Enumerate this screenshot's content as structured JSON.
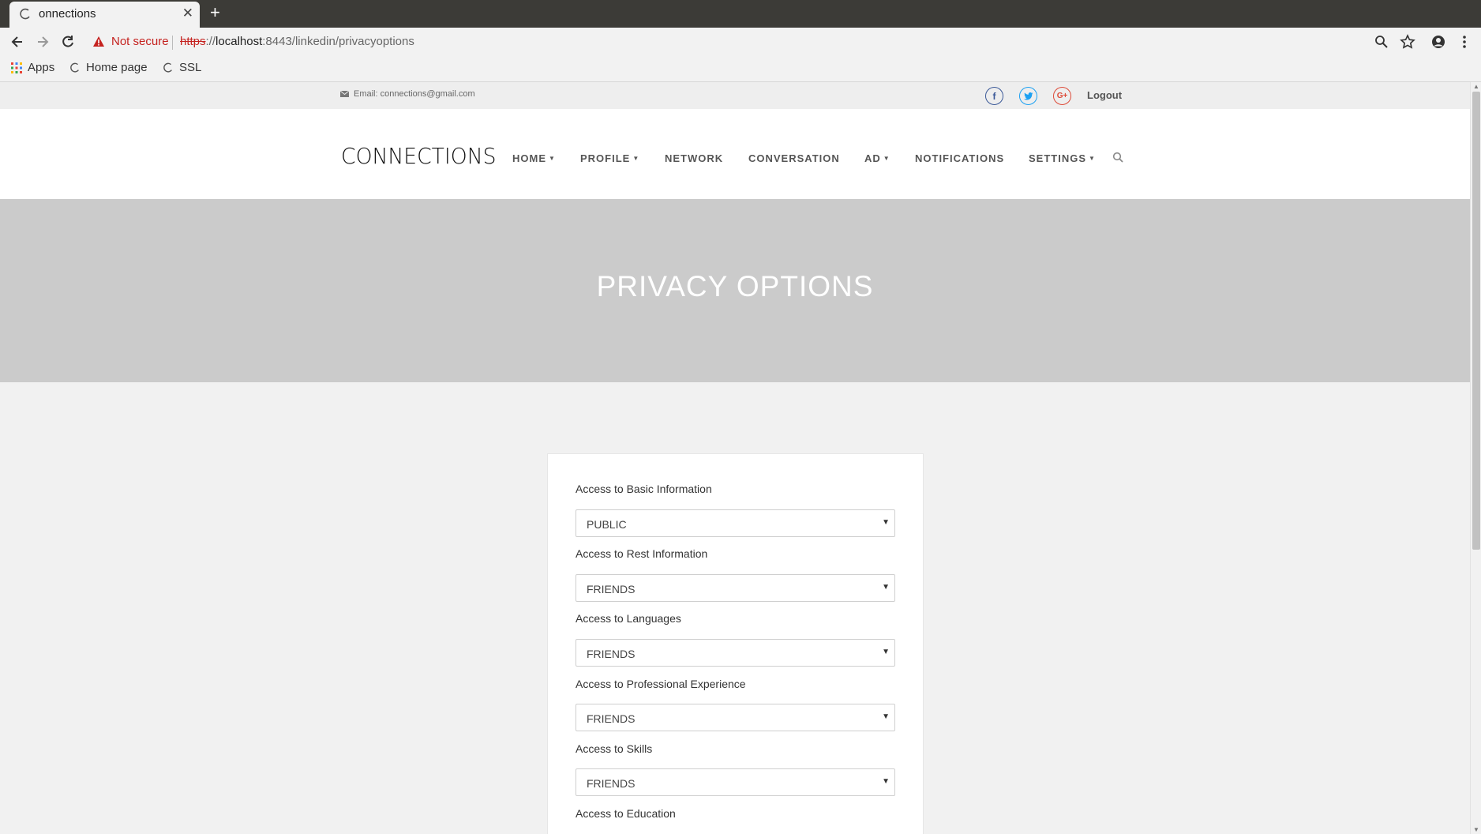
{
  "browser": {
    "tab_title": "onnections",
    "url_scheme": "https",
    "url_host": "localhost",
    "url_rest": ":8443/linkedin/privacyoptions",
    "security_label": "Not secure",
    "bookmarks": [
      "Apps",
      "Home page",
      "SSL"
    ]
  },
  "topbar": {
    "email": "Email: connections@gmail.com",
    "logout": "Logout"
  },
  "header": {
    "logo": "CONNECTIONS",
    "menu": {
      "home": "HOME",
      "profile": "PROFILE",
      "network": "NETWORK",
      "conversation": "CONVERSATION",
      "ad": "AD",
      "notifications": "NOTIFICATIONS",
      "settings": "SETTINGS"
    }
  },
  "hero": {
    "title": "PRIVACY OPTIONS"
  },
  "privacy": {
    "fields": [
      {
        "label": "Access to Basic Information",
        "value": "PUBLIC"
      },
      {
        "label": "Access to Rest Information",
        "value": "FRIENDS"
      },
      {
        "label": "Access to Languages",
        "value": "FRIENDS"
      },
      {
        "label": "Access to Professional Experience",
        "value": "FRIENDS"
      },
      {
        "label": "Access to Skills",
        "value": "FRIENDS"
      },
      {
        "label": "Access to Education",
        "value": ""
      }
    ]
  },
  "colors": {
    "facebook": "#3b5998",
    "twitter": "#1da1f2",
    "google": "#dd4b39",
    "hero_bg": "#cbcbcb"
  },
  "icons": [
    "back-icon",
    "forward-icon",
    "reload-icon",
    "warning-icon",
    "zoom-icon",
    "star-icon",
    "account-icon",
    "menu-dots-icon",
    "apps-grid-icon",
    "envelope-icon",
    "facebook-icon",
    "twitter-icon",
    "google-plus-icon",
    "search-icon",
    "dropdown-arrow-icon"
  ]
}
